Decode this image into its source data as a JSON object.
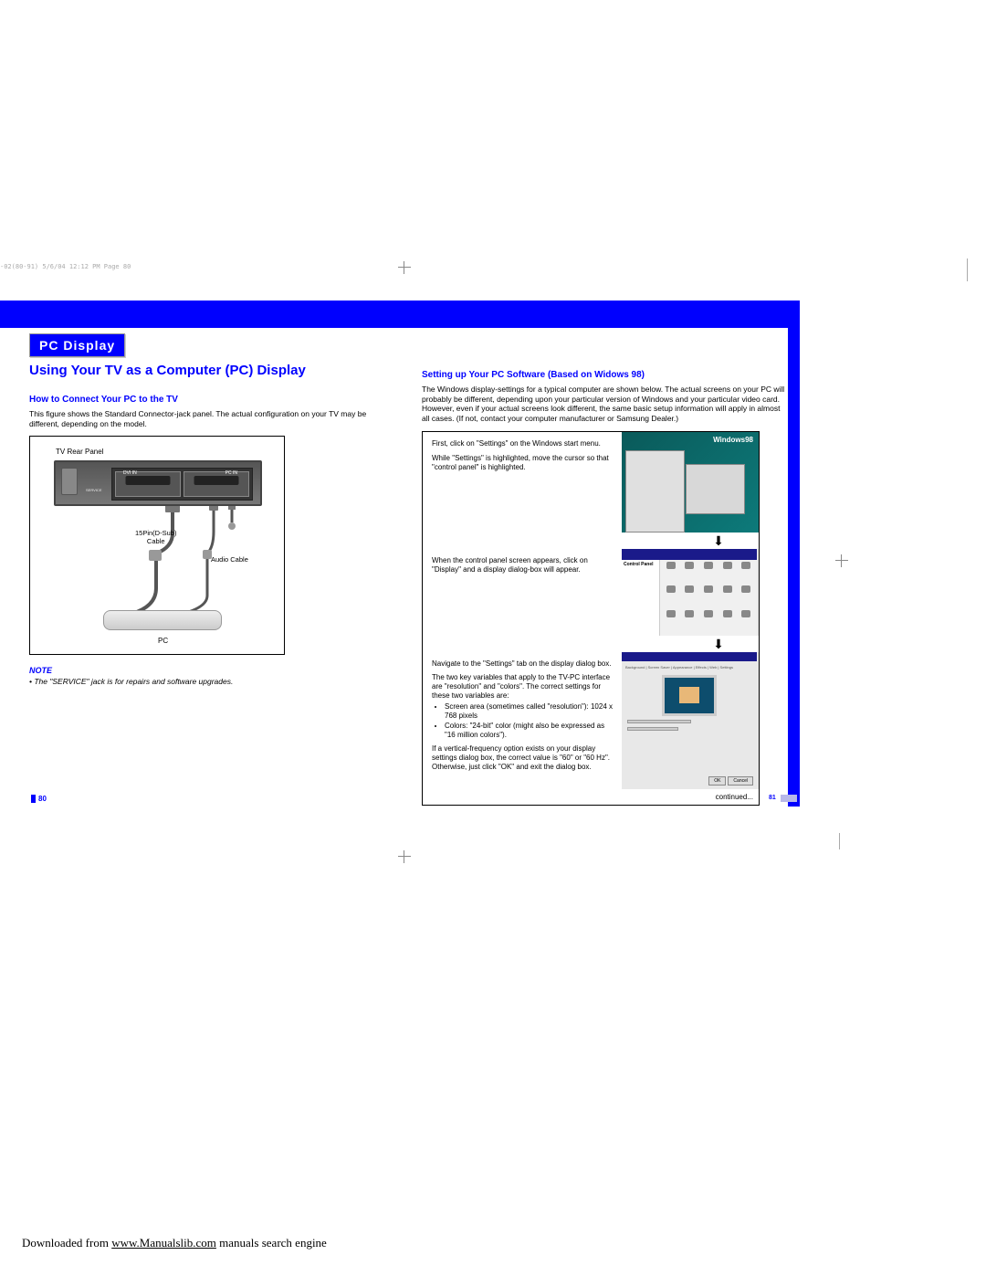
{
  "print_header": "-02(80-91)  5/6/04  12:12 PM  Page 80",
  "section_badge": "PC Display",
  "page_title": "Using Your TV as a Computer (PC) Display",
  "left": {
    "connect_heading": "How to Connect Your PC to the TV",
    "connect_body": "This figure shows the Standard Connector-jack panel. The actual configuration on your TV may be different, depending on the model.",
    "diagram": {
      "tv_label": "TV Rear Panel",
      "port_dvi": "DVI IN",
      "port_pc": "PC IN",
      "service": "SERVICE",
      "cable1_line1": "15Pin(D-Sub)",
      "cable1_line2": "Cable",
      "cable2": "Audio Cable",
      "pc_label": "PC"
    },
    "note_heading": "NOTE",
    "note_bullet": "The \"SERVICE\" jack is for repairs and software upgrades."
  },
  "right": {
    "setup_heading": "Setting up Your PC Software (Based on Widows 98)",
    "setup_intro": "The Windows display-settings for a typical computer are shown below. The actual screens on your PC will probably be different, depending upon your particular version of Windows and your particular video card. However, even if your actual screens look different, the same basic setup information will apply in almost all cases. (If not, contact your computer manufacturer or Samsung Dealer.)",
    "step1a": "First, click on \"Settings\" on the Windows start menu.",
    "step1b": "While \"Settings\" is highlighted, move the cursor so that \"control panel\" is highlighted.",
    "win_logo": "Windows98",
    "step2": "When the control panel screen appears, click on \"Display\" and a display dialog-box will appear.",
    "cp_title": "Control Panel",
    "step3a": "Navigate to the \"Settings\" tab on the display dialog box.",
    "step3b": "The two key variables that apply to the TV-PC interface are \"resolution\" and \"colors\". The correct settings for these two variables are:",
    "step3_li1": "Screen area (sometimes called \"resolution\"): 1024 x 768 pixels",
    "step3_li2": "Colors: \"24-bit\" color (might also be expressed as \"16 million colors\").",
    "step3c": "If a vertical-frequency option exists on your display settings dialog box, the correct value is \"60\" or \"60 Hz\". Otherwise, just click \"OK\" and exit the dialog box.",
    "dp_tabs": "Background | Screen Saver | Appearance | Effects | Web | Settings",
    "dp_ok": "OK",
    "dp_cancel": "Cancel",
    "continued": "continued..."
  },
  "page_left": "80",
  "page_right": "81",
  "footer": {
    "prefix": "Downloaded from ",
    "link": "www.Manualslib.com",
    "suffix": " manuals search engine"
  }
}
